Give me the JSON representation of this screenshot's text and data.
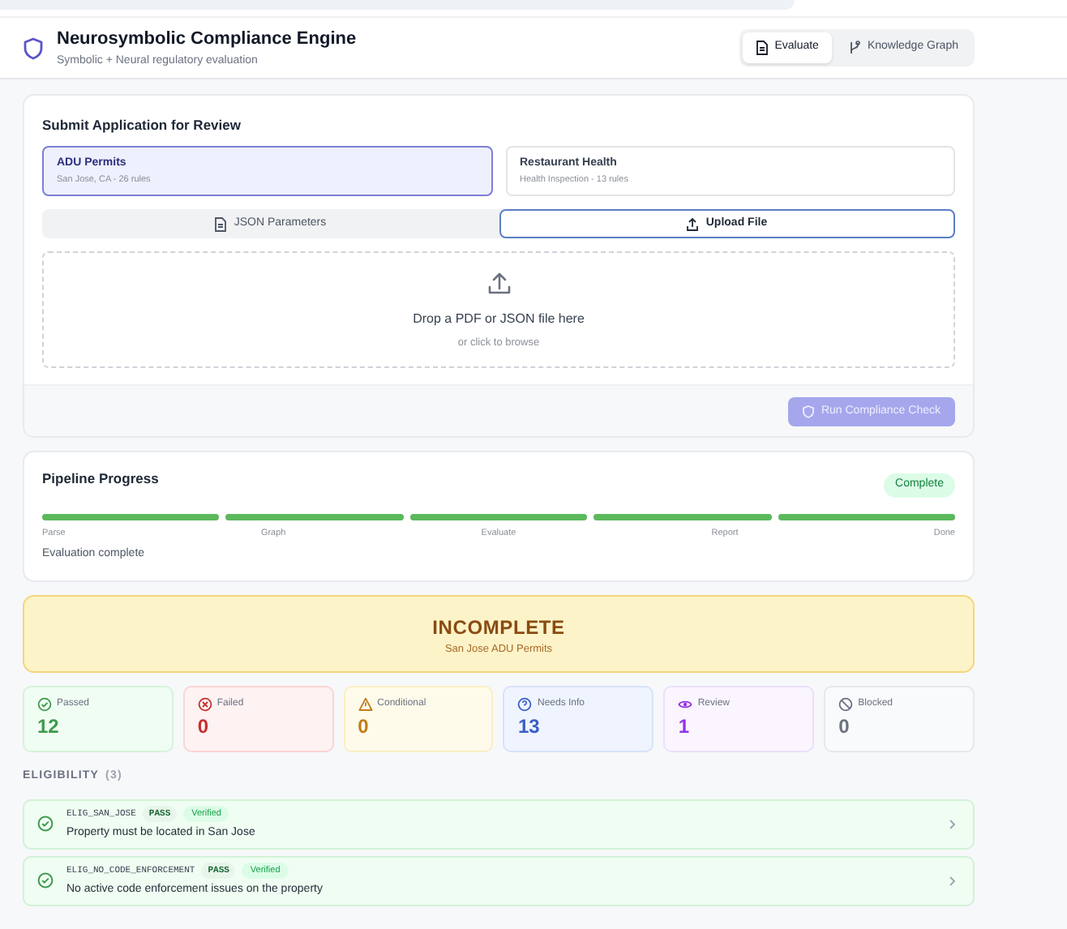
{
  "header": {
    "title": "Neurosymbolic Compliance Engine",
    "subtitle": "Symbolic + Neural regulatory evaluation",
    "nav": [
      {
        "label": "Evaluate",
        "selected": true
      },
      {
        "label": "Knowledge Graph",
        "selected": false
      }
    ]
  },
  "submit": {
    "title": "Submit Application for Review",
    "templates": [
      {
        "name": "ADU Permits",
        "detail": "San Jose, CA - 26 rules",
        "selected": true
      },
      {
        "name": "Restaurant Health",
        "detail": "Health Inspection - 13 rules",
        "selected": false
      }
    ],
    "modes": [
      {
        "label": "JSON Parameters",
        "selected": false
      },
      {
        "label": "Upload File",
        "selected": true
      }
    ],
    "dropzone": {
      "title": "Drop a PDF or JSON file here",
      "hint": "or click to browse"
    },
    "run_button": {
      "label": "Run Compliance Check",
      "disabled": true
    }
  },
  "pipeline": {
    "title": "Pipeline Progress",
    "status": "Complete",
    "steps": [
      {
        "label": "Parse",
        "done": true
      },
      {
        "label": "Graph",
        "done": true
      },
      {
        "label": "Evaluate",
        "done": true
      },
      {
        "label": "Report",
        "done": true
      },
      {
        "label": "Done",
        "done": true
      }
    ],
    "message": "Evaluation complete"
  },
  "result": {
    "verdict": "INCOMPLETE",
    "subtitle": "San Jose ADU Permits"
  },
  "stats": [
    {
      "kind": "passed",
      "label": "Passed",
      "value": "12"
    },
    {
      "kind": "failed",
      "label": "Failed",
      "value": "0"
    },
    {
      "kind": "conditional",
      "label": "Conditional",
      "value": "0"
    },
    {
      "kind": "needs_info",
      "label": "Needs Info",
      "value": "13"
    },
    {
      "kind": "review",
      "label": "Review",
      "value": "1"
    },
    {
      "kind": "blocked",
      "label": "Blocked",
      "value": "0"
    }
  ],
  "sections": [
    {
      "title": "ELIGIBILITY",
      "count": "(3)",
      "rules": [
        {
          "id": "ELIG_SAN_JOSE",
          "status": "PASS",
          "kind": "pass",
          "badge": "Verified",
          "description": "Property must be located in San Jose"
        },
        {
          "id": "ELIG_NO_CODE_ENFORCEMENT",
          "status": "PASS",
          "kind": "pass",
          "badge": "Verified",
          "description": "No active code enforcement issues on the property"
        }
      ]
    }
  ]
}
